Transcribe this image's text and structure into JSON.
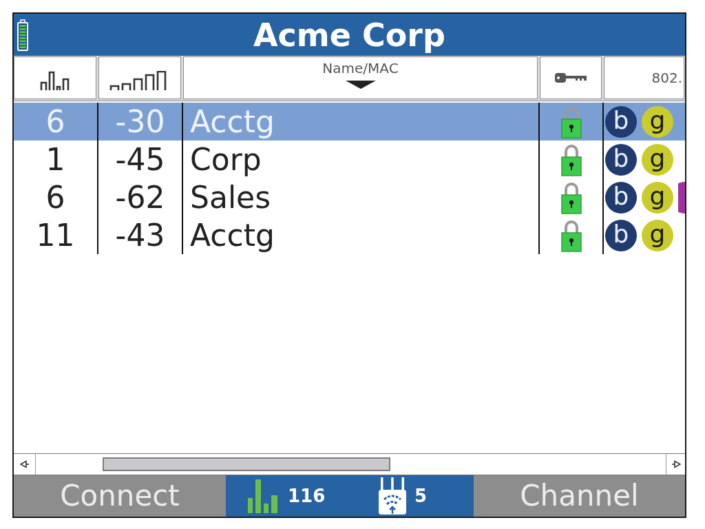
{
  "title_bar": {
    "title": "Acme Corp"
  },
  "columns": [
    {
      "kind": "channel",
      "sorted": false
    },
    {
      "kind": "signal",
      "sorted": false
    },
    {
      "kind": "text",
      "label": "Name/MAC",
      "sorted": true
    },
    {
      "kind": "security",
      "sorted": false
    },
    {
      "kind": "text",
      "label": "802.",
      "sorted": false
    }
  ],
  "rows": [
    {
      "channel": "6",
      "signal": "-30",
      "name": "Acctg",
      "secured": true,
      "selected": true,
      "standards": [
        {
          "letter": "b",
          "color": "#1f3b6f"
        },
        {
          "letter": "g",
          "color": "#c9cc2c"
        }
      ]
    },
    {
      "channel": "1",
      "signal": "-45",
      "name": "Corp",
      "secured": true,
      "selected": false,
      "standards": [
        {
          "letter": "b",
          "color": "#1f3b6f"
        },
        {
          "letter": "g",
          "color": "#c9cc2c"
        }
      ]
    },
    {
      "channel": "6",
      "signal": "-62",
      "name": "Sales",
      "secured": true,
      "selected": false,
      "standards": [
        {
          "letter": "b",
          "color": "#1f3b6f"
        },
        {
          "letter": "g",
          "color": "#c9cc2c"
        },
        {
          "color": "#a0339b"
        }
      ]
    },
    {
      "channel": "11",
      "signal": "-43",
      "name": "Acctg",
      "secured": true,
      "selected": false,
      "standards": [
        {
          "letter": "b",
          "color": "#1f3b6f"
        },
        {
          "letter": "g",
          "color": "#c9cc2c"
        }
      ]
    }
  ],
  "bottom_bar": {
    "left_button": "Connect",
    "status": [
      {
        "kind": "networks",
        "value": "116"
      },
      {
        "kind": "radios",
        "value": "5"
      }
    ],
    "right_button": "Channel"
  }
}
